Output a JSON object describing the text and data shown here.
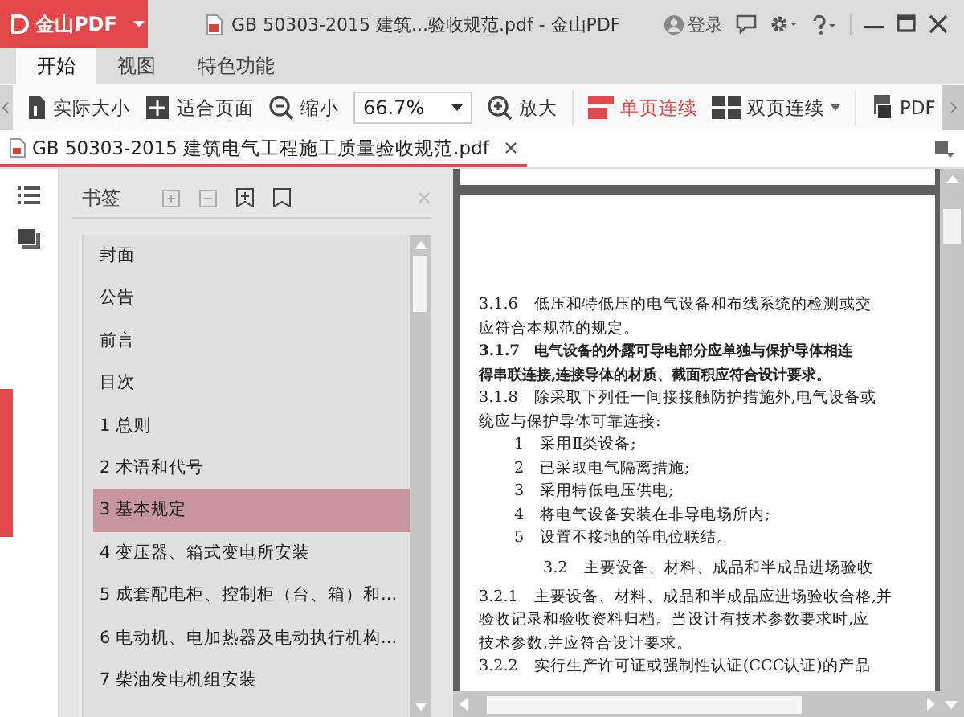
{
  "app": {
    "logo": "金山PDF"
  },
  "window": {
    "title": "GB 50303-2015 建筑...验收规范.pdf - 金山PDF",
    "login": "登录"
  },
  "tabs": [
    {
      "label": "开始",
      "selected": true
    },
    {
      "label": "视图",
      "selected": false
    },
    {
      "label": "特色功能",
      "selected": false
    }
  ],
  "toolbar": {
    "items": [
      {
        "kind": "actual",
        "label": "实际大小"
      },
      {
        "kind": "fit",
        "label": "适合页面"
      },
      {
        "kind": "zoom-out",
        "label": "缩小"
      },
      {
        "kind": "zoom-field",
        "label": "66.7%"
      },
      {
        "kind": "zoom-in",
        "label": "放大"
      },
      {
        "kind": "single",
        "label": "单页连续",
        "selected": true
      },
      {
        "kind": "double",
        "label": "双页连续",
        "selected": false
      },
      {
        "kind": "export",
        "label": "PDF"
      }
    ]
  },
  "document_tab": {
    "label": "GB 50303-2015 建筑电气工程施工质量验收规范.pdf"
  },
  "bookmarks": {
    "title": "书签",
    "items": [
      {
        "label": "封面",
        "selected": false
      },
      {
        "label": "公告",
        "selected": false
      },
      {
        "label": "前言",
        "selected": false
      },
      {
        "label": "目次",
        "selected": false
      },
      {
        "label": "1 总则",
        "selected": false
      },
      {
        "label": "2 术语和代号",
        "selected": false
      },
      {
        "label": "3 基本规定",
        "selected": true
      },
      {
        "label": "4 变压器、箱式变电所安装",
        "selected": false
      },
      {
        "label": "5 成套配电柜、控制柜（台、箱）和...",
        "selected": false
      },
      {
        "label": "6 电动机、电加热器及电动执行机构...",
        "selected": false
      },
      {
        "label": "7 柴油发电机组安装",
        "selected": false
      }
    ]
  },
  "page": {
    "lines": [
      {
        "kind": "clause",
        "num": "3.1.6",
        "text": "低压和特低压的电气设备和布线系统的检测或交",
        "bold": false
      },
      {
        "kind": "cont",
        "text": "应符合本规范的规定。",
        "bold": false
      },
      {
        "kind": "clause",
        "num": "3.1.7",
        "text": "电气设备的外露可导电部分应单独与保护导体相连",
        "bold": true
      },
      {
        "kind": "cont",
        "text": "得串联连接,连接导体的材质、截面积应符合设计要求。",
        "bold": true
      },
      {
        "kind": "clause",
        "num": "3.1.8",
        "text": "除采取下列任一间接接触防护措施外,电气设备或",
        "bold": false
      },
      {
        "kind": "cont",
        "text": "统应与保护导体可靠连接:",
        "bold": false
      },
      {
        "kind": "item",
        "num": "1",
        "text": "采用Ⅱ类设备;",
        "bold": false
      },
      {
        "kind": "item",
        "num": "2",
        "text": "已采取电气隔离措施;",
        "bold": false
      },
      {
        "kind": "item",
        "num": "3",
        "text": "采用特低电压供电;",
        "bold": false
      },
      {
        "kind": "item",
        "num": "4",
        "text": "将电气设备安装在非导电场所内;",
        "bold": false
      },
      {
        "kind": "item",
        "num": "5",
        "text": "设置不接地的等电位联结。",
        "bold": false
      },
      {
        "kind": "heading",
        "num": "3.2",
        "text": "主要设备、材料、成品和半成品进场验收",
        "bold": false
      },
      {
        "kind": "clause",
        "num": "3.2.1",
        "text": "主要设备、材料、成品和半成品应进场验收合格,并",
        "bold": false
      },
      {
        "kind": "cont",
        "text": "验收记录和验收资料归档。当设计有技术参数要求时,应",
        "bold": false
      },
      {
        "kind": "cont",
        "text": "技术参数,并应符合设计要求。",
        "bold": false
      },
      {
        "kind": "clause",
        "num": "3.2.2",
        "text": "实行生产许可证或强制性认证(CCC认证)的产品",
        "bold": false
      }
    ]
  }
}
